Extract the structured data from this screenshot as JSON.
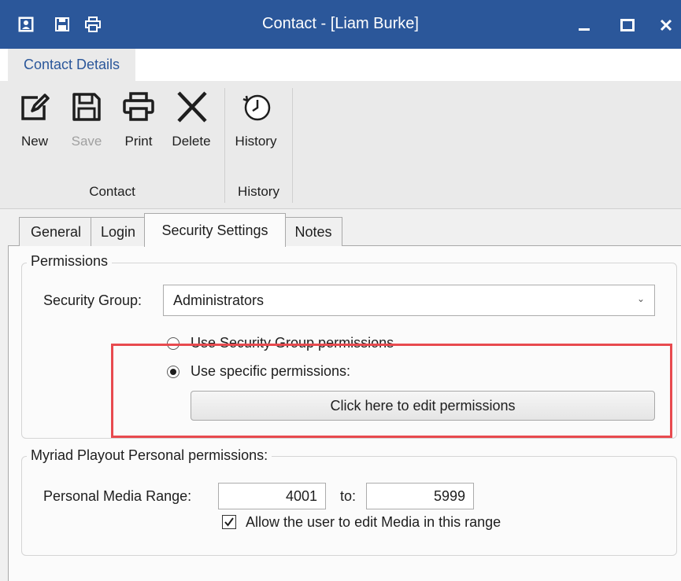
{
  "window": {
    "title": "Contact - [Liam Burke]",
    "quick_icons": [
      "contact-card-icon",
      "save-icon",
      "print-icon"
    ],
    "controls": [
      "minimize-icon",
      "maximize-icon",
      "close-icon"
    ]
  },
  "ribbon": {
    "tab": "Contact Details",
    "buttons": [
      {
        "label": "New",
        "icon": "edit-icon",
        "enabled": true
      },
      {
        "label": "Save",
        "icon": "save-icon",
        "enabled": false
      },
      {
        "label": "Print",
        "icon": "print-icon",
        "enabled": true
      },
      {
        "label": "Delete",
        "icon": "delete-x-icon",
        "enabled": true
      },
      {
        "label": "History",
        "icon": "clock-history-icon",
        "enabled": true
      }
    ],
    "groups": [
      "Contact",
      "History"
    ]
  },
  "tabs": [
    "General",
    "Login",
    "Security Settings",
    "Notes"
  ],
  "active_tab": "Security Settings",
  "permissions": {
    "legend": "Permissions",
    "security_group_label": "Security Group:",
    "security_group_value": "Administrators",
    "radio_group_perms": "Use Security Group permissions",
    "radio_specific_perms": "Use specific permissions:",
    "selected_radio": "Use specific permissions:",
    "edit_button": "Click here to edit permissions"
  },
  "personal": {
    "legend": "Myriad Playout Personal permissions:",
    "range_label": "Personal Media Range:",
    "range_from": "4001",
    "to_label": "to:",
    "range_to": "5999",
    "allow_edit_label": "Allow the user to edit Media in this range",
    "allow_edit_checked": true
  },
  "colors": {
    "title_bar": "#2b579a",
    "highlight": "#e84a4f",
    "ribbon_tab_text": "#2b579a"
  }
}
